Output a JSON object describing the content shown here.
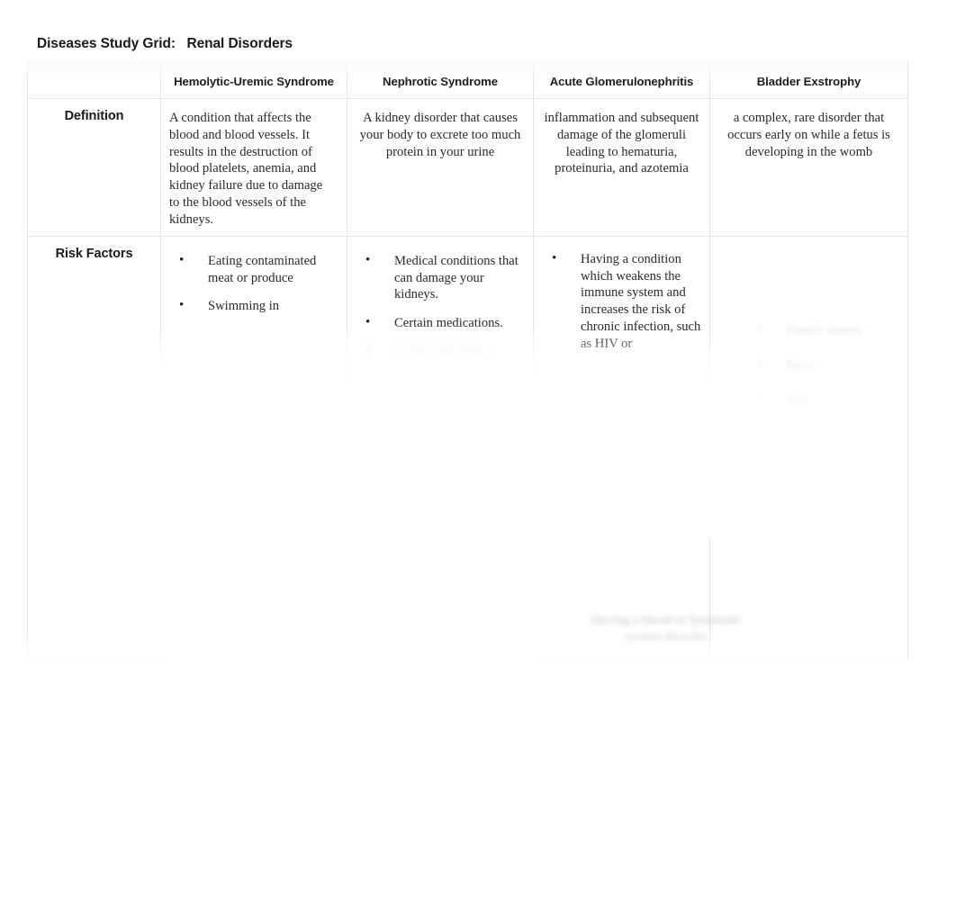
{
  "document": {
    "title_label": "Diseases Study Grid:",
    "title_subject": "Renal Disorders",
    "title_full": "Diseases Study Grid:   Renal Disorders"
  },
  "grid": {
    "corner_label": "",
    "column_headers": [
      "Hemolytic-Uremic Syndrome",
      "Nephrotic Syndrome",
      "Acute Glomerulonephritis",
      "Bladder Exstrophy"
    ],
    "row_labels": [
      "Definition",
      "Risk Factors"
    ],
    "definitions": [
      "A condition that affects the blood and blood vessels. It results in the destruction of blood platelets, anemia, and kidney failure due to damage to the blood vessels of the kidneys.",
      "A kidney disorder that causes your body to excrete too much protein in your urine",
      "inflammation and subsequent damage of the glomeruli leading to hematuria, proteinuria, and azotemia",
      "a complex, rare disorder that occurs early on while a fetus is developing in the womb"
    ],
    "risk_factors": {
      "hemolytic_uremic_syndrome": [
        "Eating contaminated meat or produce",
        "Swimming in"
      ],
      "nephrotic_syndrome": [
        "Medical conditions that can damage your kidneys.",
        "Certain medications.",
        "Certain infections."
      ],
      "acute_glomerulonephritis": [
        "Having a condition which weakens the immune system and increases the risk of chronic infection, such as HIV or"
      ],
      "acute_glomerulonephritis_faded": "Having a blood or lymphatic system disorder",
      "bladder_exstrophy": [
        "Family history",
        "Race",
        "Sex"
      ]
    }
  },
  "colors": {
    "page_background": "#ffffff",
    "text": "#2b2b2b",
    "heading": "#1a1a1a",
    "grid_border": "#e6e6e6",
    "faded_text": "#9a9a9a"
  }
}
